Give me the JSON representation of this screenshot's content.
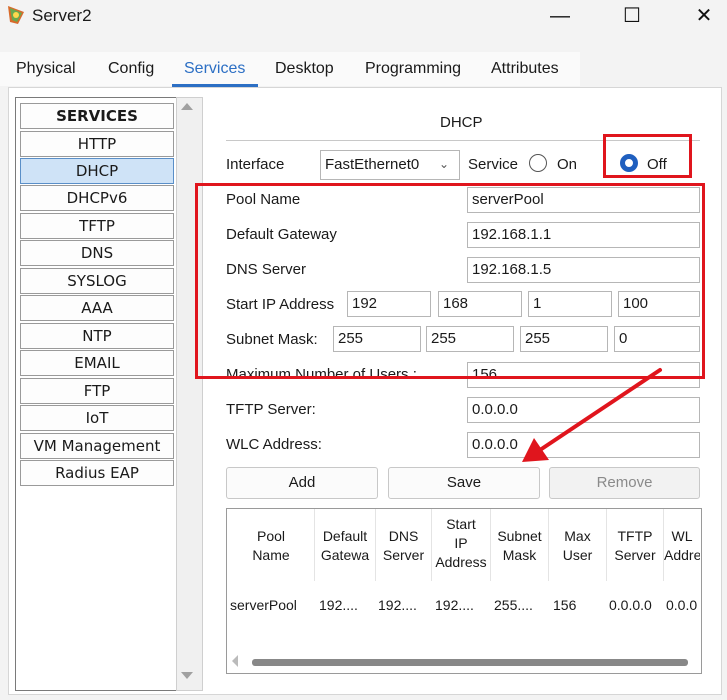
{
  "window": {
    "title": "Server2",
    "controls": {
      "minimize": "—",
      "maximize": "☐",
      "close": "✕"
    }
  },
  "tabs": [
    "Physical",
    "Config",
    "Services",
    "Desktop",
    "Programming",
    "Attributes"
  ],
  "active_tab": "Services",
  "services": {
    "header": "SERVICES",
    "items": [
      "HTTP",
      "DHCP",
      "DHCPv6",
      "TFTP",
      "DNS",
      "SYSLOG",
      "AAA",
      "NTP",
      "EMAIL",
      "FTP",
      "IoT",
      "VM Management",
      "Radius EAP"
    ],
    "selected": "DHCP"
  },
  "dhcp": {
    "title": "DHCP",
    "interface_label": "Interface",
    "interface_value": "FastEthernet0",
    "service_label": "Service",
    "on_label": "On",
    "off_label": "Off",
    "service_state": "Off",
    "pool_name_label": "Pool Name",
    "pool_name": "serverPool",
    "default_gateway_label": "Default Gateway",
    "default_gateway": "192.168.1.1",
    "dns_server_label": "DNS Server",
    "dns_server": "192.168.1.5",
    "start_ip_label": "Start IP Address",
    "start_ip": [
      "192",
      "168",
      "1",
      "100"
    ],
    "subnet_mask_label": "Subnet Mask:",
    "subnet_mask": [
      "255",
      "255",
      "255",
      "0"
    ],
    "max_users_label": "Maximum Number of Users :",
    "max_users": "156",
    "tftp_label": "TFTP Server:",
    "tftp": "0.0.0.0",
    "wlc_label": "WLC Address:",
    "wlc": "0.0.0.0"
  },
  "buttons": {
    "add": "Add",
    "save": "Save",
    "remove": "Remove"
  },
  "table": {
    "headers": [
      [
        "Pool",
        "Name"
      ],
      [
        "Default",
        "Gatewa"
      ],
      [
        "DNS",
        "Server"
      ],
      [
        "Start",
        "IP",
        "Address"
      ],
      [
        "Subnet",
        "Mask"
      ],
      [
        "Max",
        "User"
      ],
      [
        "TFTP",
        "Server"
      ],
      [
        "WL",
        "Addre"
      ]
    ],
    "rows": [
      [
        "serverPool",
        "192....",
        "192....",
        "192....",
        "255....",
        "156",
        "0.0.0.0",
        "0.0.0"
      ]
    ]
  },
  "colors": {
    "accent": "#2c6fc4",
    "highlight": "#e0151d",
    "radio": "#1f5fbf"
  },
  "icons": [
    "app-icon",
    "chevron-down-icon",
    "scroll-up-icon",
    "scroll-down-icon",
    "annotation-arrow"
  ]
}
